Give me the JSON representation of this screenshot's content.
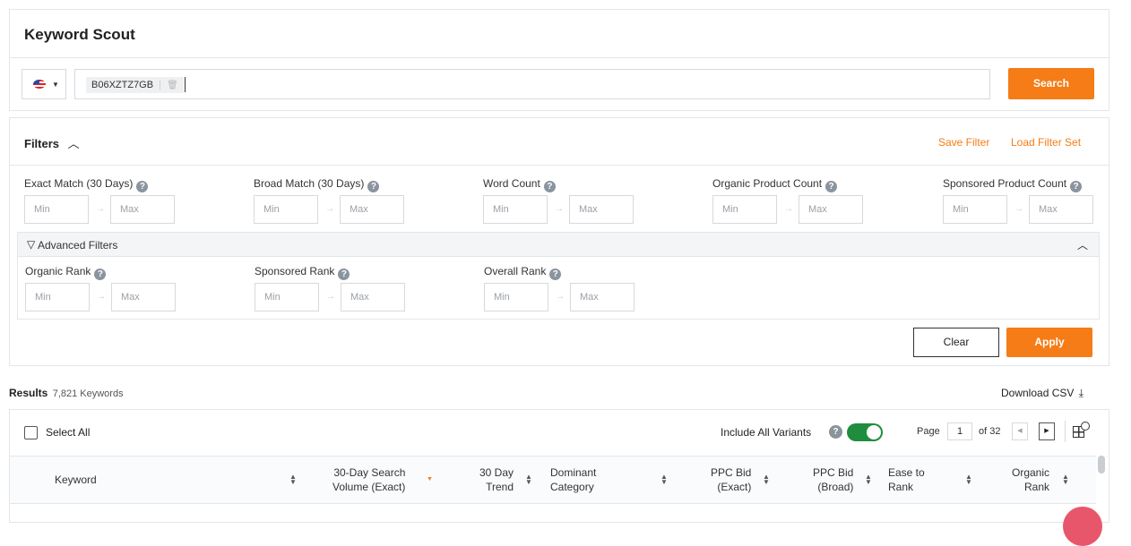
{
  "app": {
    "title": "Keyword Scout"
  },
  "search": {
    "chip": "B06XZTZ7GB",
    "button": "Search"
  },
  "filters": {
    "title": "Filters",
    "save_filter": "Save Filter",
    "load_filter_set": "Load Filter Set",
    "min": "Min",
    "max": "Max",
    "groups": [
      {
        "label": "Exact Match (30 Days)"
      },
      {
        "label": "Broad Match (30 Days)"
      },
      {
        "label": "Word Count"
      },
      {
        "label": "Organic Product Count"
      },
      {
        "label": "Sponsored Product Count"
      }
    ],
    "advanced": {
      "title": "Advanced Filters",
      "groups": [
        {
          "label": "Organic Rank"
        },
        {
          "label": "Sponsored Rank"
        },
        {
          "label": "Overall Rank"
        }
      ]
    },
    "clear": "Clear",
    "apply": "Apply"
  },
  "results": {
    "label": "Results",
    "count": "7,821 Keywords",
    "download": "Download CSV",
    "select_all": "Select All",
    "include_variants": "Include All Variants",
    "include_variants_on": true,
    "page_label": "Page",
    "page_value": "1",
    "page_of": "of 32",
    "columns": [
      {
        "l1": "Keyword",
        "l2": ""
      },
      {
        "l1": "30-Day Search",
        "l2": "Volume (Exact)"
      },
      {
        "l1": "30 Day",
        "l2": "Trend"
      },
      {
        "l1": "Dominant",
        "l2": "Category"
      },
      {
        "l1": "PPC Bid",
        "l2": "(Exact)"
      },
      {
        "l1": "PPC Bid",
        "l2": "(Broad)"
      },
      {
        "l1": "Ease to",
        "l2": "Rank"
      },
      {
        "l1": "Organic",
        "l2": "Rank"
      }
    ]
  },
  "colors": {
    "accent": "#f57c16",
    "toggle": "#1e8e3e"
  }
}
